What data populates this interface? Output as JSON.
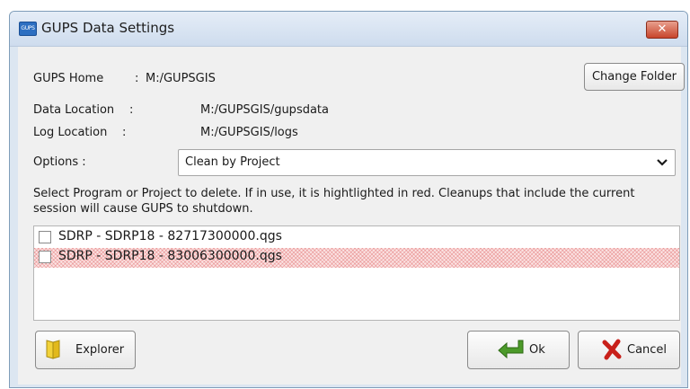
{
  "window": {
    "title": "GUPS Data Settings",
    "app_icon_text": "GUPS",
    "close_glyph": "✕"
  },
  "home": {
    "label": "GUPS Home",
    "separator": ":",
    "value": "M:/GUPSGIS",
    "change_folder_label": "Change Folder"
  },
  "data_location": {
    "label": "Data Location",
    "separator": ":",
    "value": "M:/GUPSGIS/gupsdata"
  },
  "log_location": {
    "label": "Log Location",
    "separator": ":",
    "value": "M:/GUPSGIS/logs"
  },
  "options": {
    "label": "Options :",
    "selected": "Clean by Project",
    "arrow_glyph": "⌄"
  },
  "instructions": "Select Program or Project to delete. If in use, it is hightlighted in red. Cleanups that include the current session will cause GUPS to shutdown.",
  "projects": [
    {
      "label": "SDRP - SDRP18 - 82717300000.qgs",
      "checked": false,
      "in_use": false
    },
    {
      "label": "SDRP - SDRP18 - 83006300000.qgs",
      "checked": false,
      "in_use": true
    }
  ],
  "buttons": {
    "explorer_label": "Explorer",
    "ok_label": "Ok",
    "cancel_label": "Cancel"
  },
  "colors": {
    "in_use_highlight": "#e05a5a",
    "title_bar": "#dce6f1",
    "close_button": "#c8452c"
  },
  "icons": {
    "explorer": "folder-icon",
    "ok": "green-arrow-icon",
    "cancel": "red-x-icon"
  }
}
